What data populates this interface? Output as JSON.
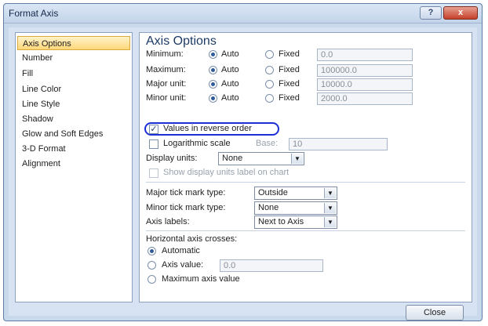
{
  "window": {
    "title": "Format Axis",
    "help_label": "?",
    "close_label": "x"
  },
  "sidebar": {
    "items": [
      {
        "label": "Axis Options"
      },
      {
        "label": "Number"
      },
      {
        "label": "Fill"
      },
      {
        "label": "Line Color"
      },
      {
        "label": "Line Style"
      },
      {
        "label": "Shadow"
      },
      {
        "label": "Glow and Soft Edges"
      },
      {
        "label": "3-D Format"
      },
      {
        "label": "Alignment"
      }
    ],
    "selected": "Axis Options"
  },
  "panel": {
    "heading": "Axis Options",
    "rows": [
      {
        "label": "Minimum:",
        "auto": "Auto",
        "fixed": "Fixed",
        "value": "0.0"
      },
      {
        "label": "Maximum:",
        "auto": "Auto",
        "fixed": "Fixed",
        "value": "100000.0"
      },
      {
        "label": "Major unit:",
        "auto": "Auto",
        "fixed": "Fixed",
        "value": "10000.0"
      },
      {
        "label": "Minor unit:",
        "auto": "Auto",
        "fixed": "Fixed",
        "value": "2000.0"
      }
    ],
    "reverse_order": {
      "label": "Values in reverse order",
      "checked": true
    },
    "log_scale": {
      "label": "Logarithmic scale",
      "base_label": "Base:",
      "base_value": "10",
      "checked": false
    },
    "display_units": {
      "label": "Display units:",
      "value": "None"
    },
    "show_units_label": {
      "label": "Show display units label on chart"
    },
    "major_tick": {
      "label": "Major tick mark type:",
      "value": "Outside"
    },
    "minor_tick": {
      "label": "Minor tick mark type:",
      "value": "None"
    },
    "axis_labels": {
      "label": "Axis labels:",
      "value": "Next to Axis"
    },
    "crosses": {
      "label": "Horizontal axis crosses:",
      "automatic": "Automatic",
      "axis_value_label": "Axis value:",
      "axis_value": "0.0",
      "maximum": "Maximum axis value",
      "selected": "Automatic"
    }
  },
  "footer": {
    "close_label": "Close"
  },
  "colors": {
    "highlight_circle": "#1f2fd6",
    "selected_nav": "#ffd77a"
  }
}
